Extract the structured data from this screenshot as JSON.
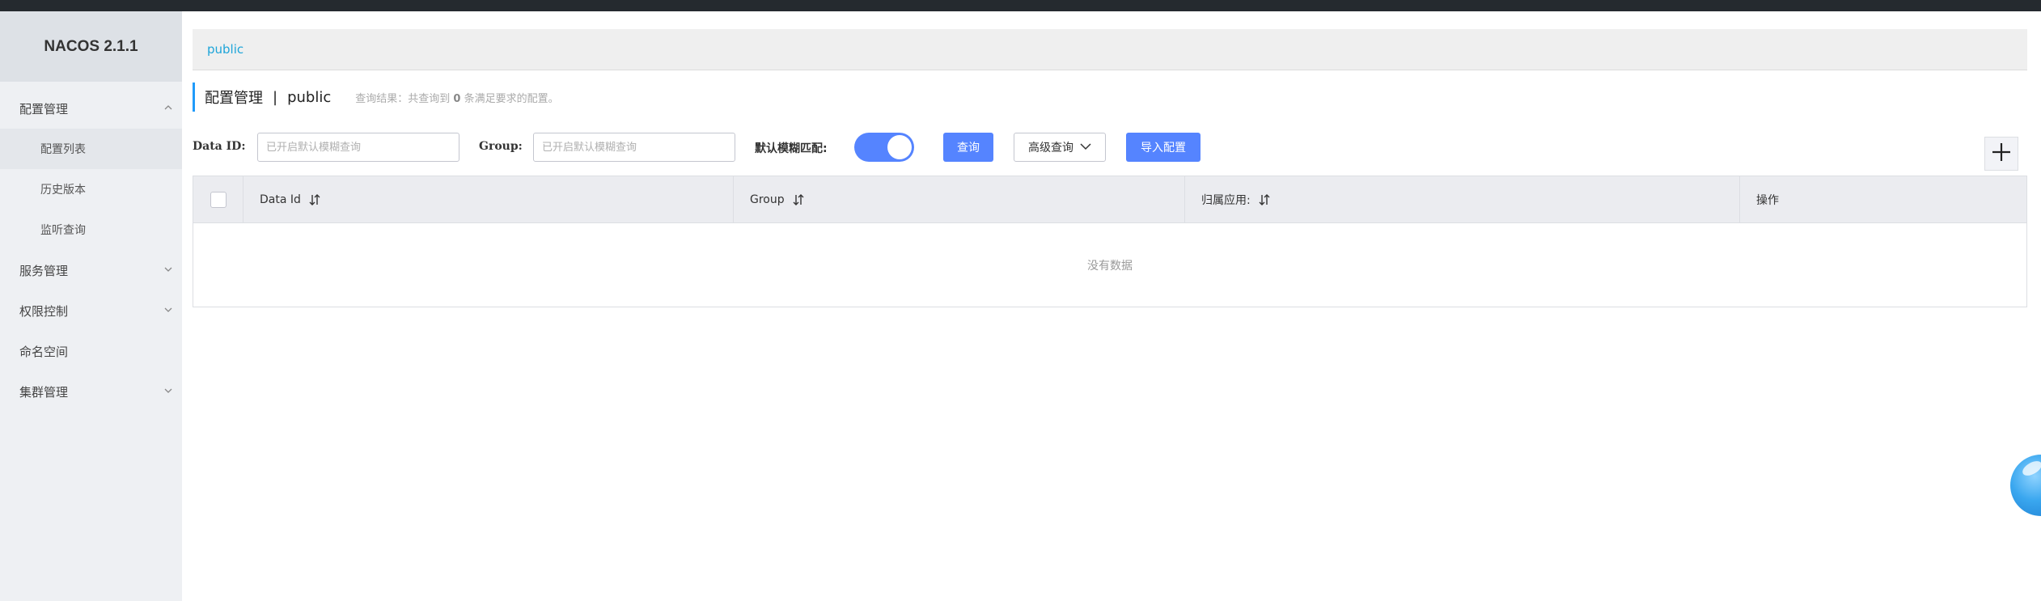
{
  "app": {
    "brand": "NACOS 2.1.1"
  },
  "sidebar": {
    "config_mgmt": "配置管理",
    "config_list": "配置列表",
    "history": "历史版本",
    "listen_query": "监听查询",
    "service_mgmt": "服务管理",
    "access_control": "权限控制",
    "namespace": "命名空间",
    "cluster_mgmt": "集群管理"
  },
  "namespace_bar": {
    "current": "public"
  },
  "page": {
    "title": "配置管理",
    "separator": "|",
    "namespace": "public",
    "result_prefix": "查询结果：共查询到",
    "result_count": "0",
    "result_suffix": "条满足要求的配置。"
  },
  "toolbar": {
    "data_id_label": "Data ID:",
    "data_id_placeholder": "已开启默认模糊查询",
    "group_label": "Group:",
    "group_placeholder": "已开启默认模糊查询",
    "fuzzy_label": "默认模糊匹配:",
    "fuzzy_on": true,
    "query_button": "查询",
    "advanced_button": "高级查询",
    "import_button": "导入配置"
  },
  "table": {
    "columns": [
      "Data Id",
      "Group",
      "归属应用:",
      "操作"
    ],
    "empty_text": "没有数据"
  },
  "icons": {
    "add": "plus-icon",
    "sort": "sort-icon",
    "chevron": "chevron-icon"
  },
  "colors": {
    "primary": "#5584ff",
    "accent": "#209bfa",
    "link": "#1ea5d9"
  }
}
